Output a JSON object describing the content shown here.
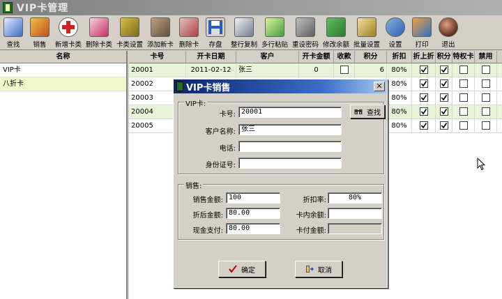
{
  "window": {
    "title": "VIP卡管理"
  },
  "toolbar": [
    {
      "label": "查找",
      "icon": "search-doc-icon"
    },
    {
      "label": "销售",
      "icon": "people-icon"
    },
    {
      "label": "新增卡类",
      "icon": "add-red-cross-icon"
    },
    {
      "label": "删除卡类",
      "icon": "delete-card-icon"
    },
    {
      "label": "卡类设置",
      "icon": "gear-icon"
    },
    {
      "label": "添加新卡",
      "icon": "add-card-icon"
    },
    {
      "label": "删除卡",
      "icon": "remove-card-icon"
    },
    {
      "label": "存盘",
      "icon": "floppy-disk-icon"
    },
    {
      "label": "整行复制",
      "icon": "copy-row-icon"
    },
    {
      "label": "多行粘贴",
      "icon": "paste-rows-icon"
    },
    {
      "label": "重设密码",
      "icon": "keys-icon"
    },
    {
      "label": "修改余额",
      "icon": "money-bag-icon"
    },
    {
      "label": "批量设置",
      "icon": "batch-settings-icon"
    },
    {
      "label": "设置",
      "icon": "settings-globe-icon"
    },
    {
      "label": "打印",
      "icon": "printer-chart-icon"
    },
    {
      "label": "退出",
      "icon": "exit-icon"
    }
  ],
  "left_panel": {
    "header": "名称",
    "items": [
      "VIP卡",
      "八折卡"
    ]
  },
  "grid": {
    "columns": [
      "卡号",
      "开卡日期",
      "客户",
      "开卡金额",
      "收款",
      "积分",
      "折扣",
      "折上折",
      "积分",
      "特权卡",
      "禁用"
    ],
    "rows": [
      {
        "card_no": "20001",
        "date": "2011-02-12",
        "customer": "张三",
        "amount": "0",
        "points": "6",
        "discount": "80%"
      },
      {
        "card_no": "20002",
        "date": "",
        "customer": "",
        "amount": "",
        "points": "",
        "discount": "80%"
      },
      {
        "card_no": "20003",
        "date": "",
        "customer": "",
        "amount": "",
        "points": "",
        "discount": "80%"
      },
      {
        "card_no": "20004",
        "date": "",
        "customer": "",
        "amount": "",
        "points": "",
        "discount": "80%"
      },
      {
        "card_no": "20005",
        "date": "",
        "customer": "",
        "amount": "",
        "points": "",
        "discount": "80%"
      }
    ]
  },
  "dialog": {
    "title": "VIP卡销售",
    "close": "✕",
    "vip_group": {
      "title": "VIP卡:",
      "card_no_label": "卡号:",
      "card_no_value": "20001",
      "find_button": "查找",
      "customer_label": "客户名称:",
      "customer_value": "张三",
      "phone_label": "电话:",
      "phone_value": "",
      "id_label": "身份证号:",
      "id_value": ""
    },
    "sale_group": {
      "title": "销售:",
      "sale_amount_label": "销售金额:",
      "sale_amount_value": "100",
      "discount_rate_label": "折扣率:",
      "discount_rate_value": "80%",
      "discounted_label": "折后金额:",
      "discounted_value": "80.00",
      "balance_label": "卡内余额:",
      "balance_value": "",
      "cash_label": "现金支付:",
      "cash_value": "80.00",
      "card_pay_label": "卡付金额:",
      "card_pay_value": ""
    },
    "ok_button": "确定",
    "cancel_button": "取消"
  },
  "colors": {
    "dialog_title_start": "#0a246a",
    "dialog_title_end": "#a6caf0",
    "selected_row": "#f0f8cc",
    "alt_row": "#e8f4d8"
  }
}
